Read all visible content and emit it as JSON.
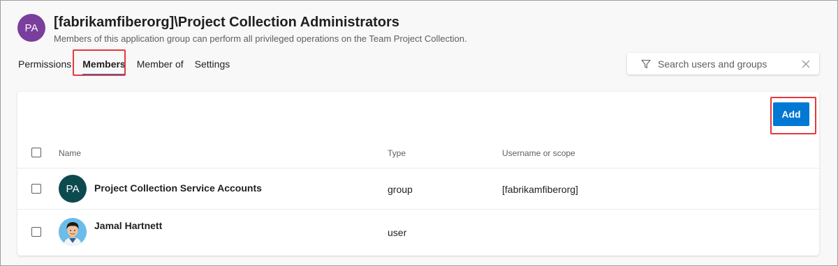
{
  "group": {
    "avatar_initials": "PA",
    "title": "[fabrikamfiberorg]\\Project Collection Administrators",
    "subtitle": "Members of this application group can perform all privileged operations on the Team Project Collection."
  },
  "tabs": [
    {
      "label": "Permissions",
      "selected": false
    },
    {
      "label": "Members",
      "selected": true
    },
    {
      "label": "Member of",
      "selected": false
    },
    {
      "label": "Settings",
      "selected": false
    }
  ],
  "search": {
    "placeholder": "Search users and groups",
    "value": ""
  },
  "toolbar": {
    "add_label": "Add"
  },
  "table": {
    "columns": [
      "Name",
      "Type",
      "Username or scope"
    ],
    "rows": [
      {
        "avatar_initials": "PA",
        "name": "Project Collection Service Accounts",
        "type": "group",
        "scope": "[fabrikamfiberorg]"
      },
      {
        "avatar_initials": "",
        "name": "Jamal Hartnett",
        "type": "user",
        "scope": ""
      }
    ]
  },
  "colors": {
    "group_avatar": "#7a3e9d",
    "row_avatar": "#0c4a4f",
    "accent": "#0078d4",
    "highlight": "#e6383f"
  }
}
